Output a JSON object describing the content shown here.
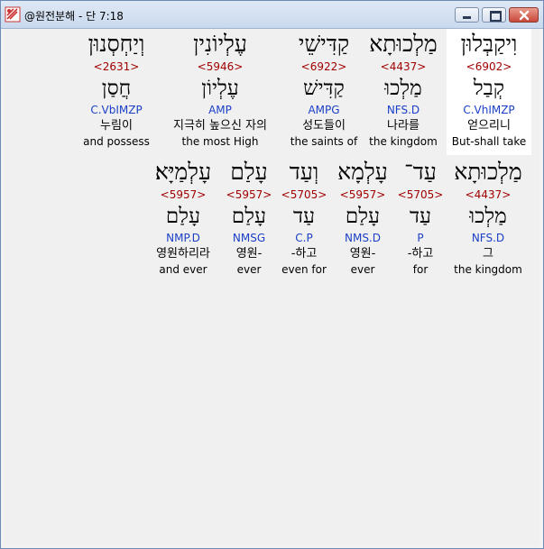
{
  "window": {
    "title": "@원전분해 - 단 7:18",
    "minimize_icon": "minimize-icon",
    "maximize_icon": "maximize-icon",
    "close_icon": "close-icon"
  },
  "rows": [
    {
      "words": [
        {
          "hebrew": "וִיקַבְּלוּן",
          "strong": "<6902>",
          "lemma": "קְבַל",
          "parse": "C.VhIMZP",
          "korean": "얻으리니",
          "english": "But-shall take"
        },
        {
          "hebrew": "מַלְכוּתָא",
          "strong": "<4437>",
          "lemma": "מַלְכוּ",
          "parse": "NFS.D",
          "korean": "나라를",
          "english": "the kingdom"
        },
        {
          "hebrew": "קַדִּישֵׁי",
          "strong": "<6922>",
          "lemma": "קַדִּישׁ",
          "parse": "AMPG",
          "korean": "성도들이",
          "english": "the saints of"
        },
        {
          "hebrew": "עֶלְיוֹנִין",
          "strong": "<5946>",
          "lemma": "עֶלְיוֹן",
          "parse": "AMP",
          "korean": "지극히 높으신 자의",
          "english": "the most High"
        },
        {
          "hebrew": "וְיַחְסְנוּן",
          "strong": "<2631>",
          "lemma": "חֲסַן",
          "parse": "C.VbIMZP",
          "korean": "누림이",
          "english": "and possess"
        }
      ]
    },
    {
      "words": [
        {
          "hebrew": "מַלְכוּתָא",
          "strong": "<4437>",
          "lemma": "מַלְכוּ",
          "parse": "NFS.D",
          "korean": "그",
          "english": "the kingdom"
        },
        {
          "hebrew": "עַד־",
          "strong": "<5705>",
          "lemma": "עַד",
          "parse": "P",
          "korean": "-하고",
          "english": "for"
        },
        {
          "hebrew": "עָלְמָא",
          "strong": "<5957>",
          "lemma": "עָלַם",
          "parse": "NMS.D",
          "korean": "영원-",
          "english": "ever"
        },
        {
          "hebrew": "וְעַד",
          "strong": "<5705>",
          "lemma": "עַד",
          "parse": "C.P",
          "korean": "-하고",
          "english": "even for"
        },
        {
          "hebrew": "עָלַם",
          "strong": "<5957>",
          "lemma": "עָלַם",
          "parse": "NMSG",
          "korean": "영원-",
          "english": "ever"
        },
        {
          "hebrew": "עָלְמַיָּא׃",
          "strong": "<5957>",
          "lemma": "עָלַם",
          "parse": "NMP.D",
          "korean": "영원하리라",
          "english": "and ever"
        }
      ]
    }
  ]
}
